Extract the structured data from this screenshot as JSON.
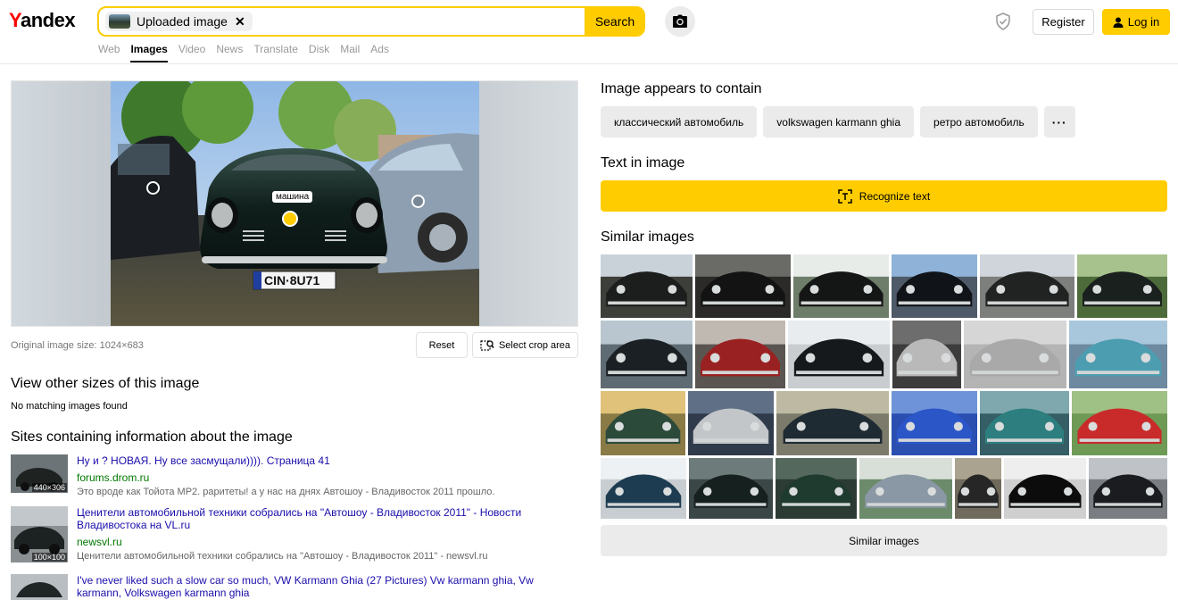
{
  "header": {
    "logo_y": "Y",
    "logo_rest": "andex",
    "search_chip_label": "Uploaded image",
    "search_chip_close": "✕",
    "search_button": "Search",
    "register": "Register",
    "login": "Log in",
    "nav": [
      "Web",
      "Images",
      "Video",
      "News",
      "Translate",
      "Disk",
      "Mail",
      "Ads"
    ],
    "nav_active": "Images",
    "icons": [
      "camera-icon",
      "shield-icon",
      "user-icon"
    ],
    "accent_color": "#ffcc00"
  },
  "preview": {
    "hotspot_label": "машина",
    "original_size": "Original image size: 1024×683",
    "reset": "Reset",
    "crop": "Select crop area",
    "plate_text": "CIN·8U71"
  },
  "other_sizes": {
    "heading": "View other sizes of this image",
    "message": "No matching images found"
  },
  "sites": {
    "heading": "Sites containing information about the image",
    "items": [
      {
        "title": "Ну и ? НОВАЯ. Ну все засмущали)))). Страница 41",
        "domain": "forums.drom.ru",
        "snippet": "Это вроде как Тойота MP2. раритеты! а у нас на днях Автошоу - Владивосток 2011 прошло.",
        "dims": "440×306"
      },
      {
        "title": "Ценители автомобильной техники собрались на \"Автошоу - Владивосток 2011\" - Новости Владивостока на VL.ru",
        "domain": "newsvl.ru",
        "snippet": "Ценители автомобильной техники собрались на \"Автошоу - Владивосток 2011\" - newsvl.ru",
        "dims": "100×100"
      },
      {
        "title": "I've never liked such a slow car so much, VW Karmann Ghia (27 Pictures) Vw karmann ghia, Vw karmann, Volkswagen karmann ghia",
        "domain": "",
        "snippet": "",
        "dims": ""
      }
    ]
  },
  "contains": {
    "heading": "Image appears to contain",
    "tags": [
      "классический автомобиль",
      "volkswagen karmann ghia",
      "ретро автомобиль"
    ],
    "more": "···"
  },
  "text_in_image": {
    "heading": "Text in image",
    "button": "Recognize text"
  },
  "similar": {
    "heading": "Similar images",
    "button": "Similar images",
    "thumbs": [
      {
        "bg": "#3c3f3a",
        "car": "#1b1e1c",
        "sky": "#c9d2d9"
      },
      {
        "bg": "#2b2a28",
        "car": "#121312",
        "sky": "#6a6a66"
      },
      {
        "bg": "#6e7d6a",
        "car": "#141515",
        "sky": "#e7ece9"
      },
      {
        "bg": "#4f5a68",
        "car": "#101419",
        "sky": "#8fb2d8"
      },
      {
        "bg": "#7d7f7c",
        "car": "#202322",
        "sky": "#cfd5da"
      },
      {
        "bg": "#4d6b3a",
        "car": "#1a201d",
        "sky": "#a7c28d"
      },
      {
        "bg": "#5f6b73",
        "car": "#1b2024",
        "sky": "#b9c6cf"
      },
      {
        "bg": "#5a5550",
        "car": "#9a2121",
        "sky": "#c0b9b2"
      },
      {
        "bg": "#c9cdd0",
        "car": "#15191b",
        "sky": "#e8ecee"
      },
      {
        "bg": "#3c3c3c",
        "car": "#b9b9b9",
        "sky": "#6d6d6d"
      },
      {
        "bg": "#b4b4b4",
        "car": "#a9a9a9",
        "sky": "#d6d6d6"
      },
      {
        "bg": "#6d8aa0",
        "car": "#4d9db0",
        "sky": "#a9c7dc"
      },
      {
        "bg": "#8a7a45",
        "car": "#2c4a3a",
        "sky": "#e0c27a"
      },
      {
        "bg": "#2f3a4b",
        "car": "#c2c6c9",
        "sky": "#5e6f86"
      },
      {
        "bg": "#7c7a6b",
        "car": "#1f2b33",
        "sky": "#bdb9a2"
      },
      {
        "bg": "#2a4fb0",
        "car": "#2a56c8",
        "sky": "#6f93d8"
      },
      {
        "bg": "#355e66",
        "car": "#2d7e7e",
        "sky": "#7ea8ad"
      },
      {
        "bg": "#6e9a55",
        "car": "#c92b2b",
        "sky": "#9fc185"
      },
      {
        "bg": "#c8cdd1",
        "car": "#1d3c52",
        "sky": "#eef1f3"
      },
      {
        "bg": "#3b4747",
        "car": "#16201f",
        "sky": "#6d7b7a"
      },
      {
        "bg": "#2d3b35",
        "car": "#1f3a2f",
        "sky": "#54685d"
      },
      {
        "bg": "#6b8b6a",
        "car": "#8a97a5",
        "sky": "#d7dfd8"
      },
      {
        "bg": "#6f6a5c",
        "car": "#262626",
        "sky": "#a9a38f"
      },
      {
        "bg": "#cfcfcf",
        "car": "#0c0c0c",
        "sky": "#eeeeee"
      },
      {
        "bg": "#7a7d82",
        "car": "#1a1c20",
        "sky": "#bfc3c8"
      }
    ]
  }
}
